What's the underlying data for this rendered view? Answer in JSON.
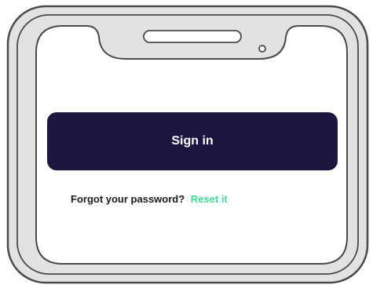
{
  "signin": {
    "button_label": "Sign in"
  },
  "recovery": {
    "prompt": "Forgot your password?",
    "link_label": "Reset it"
  },
  "colors": {
    "button_bg": "#1b1740",
    "button_text": "#ffffff",
    "link": "#3ddc97",
    "frame_fill": "#e2e2e2",
    "frame_stroke": "#4a4a4a"
  }
}
